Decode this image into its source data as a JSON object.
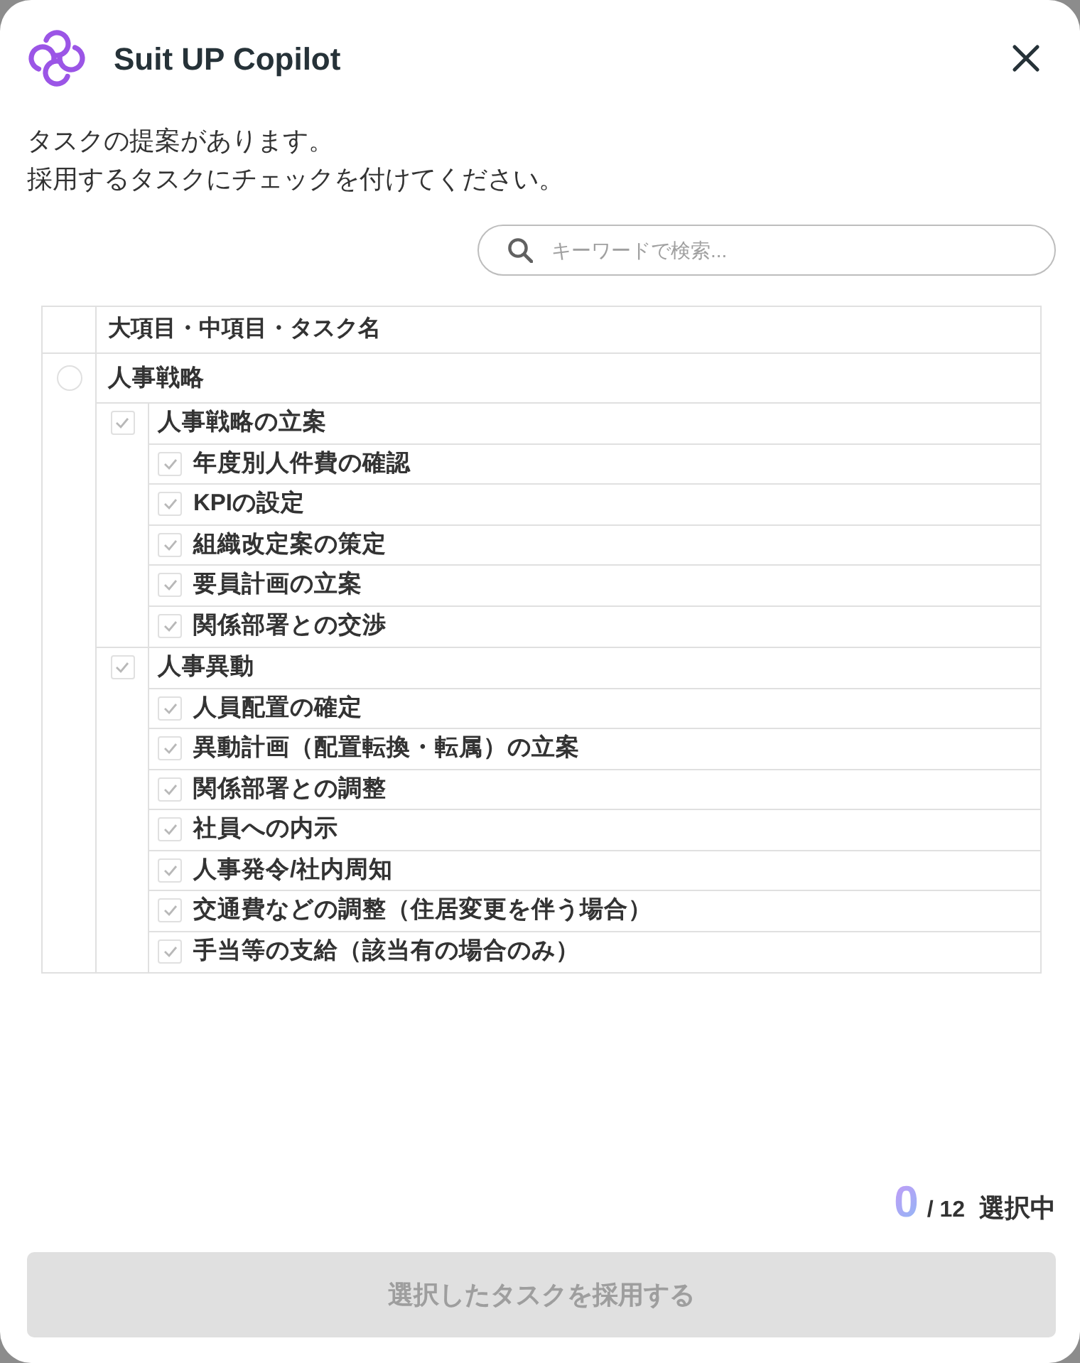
{
  "header": {
    "title": "Suit UP Copilot"
  },
  "intro": [
    "タスクの提案があります。",
    "採用するタスクにチェックを付けてください。"
  ],
  "search": {
    "placeholder": "キーワードで検索..."
  },
  "table": {
    "columns": [
      "大項目・中項目・タスク名"
    ],
    "categories": [
      {
        "label": "人事戦略",
        "selected": false,
        "children": [
          {
            "label": "人事戦略の立案",
            "checked": true,
            "disabled": true,
            "children": [
              {
                "label": "年度別人件費の確認",
                "checked": true,
                "disabled": true
              },
              {
                "label": "KPIの設定",
                "checked": true,
                "disabled": true
              },
              {
                "label": "組織改定案の策定",
                "checked": true,
                "disabled": true
              },
              {
                "label": "要員計画の立案",
                "checked": true,
                "disabled": true
              },
              {
                "label": "関係部署との交渉",
                "checked": true,
                "disabled": true
              }
            ]
          },
          {
            "label": "人事異動",
            "checked": true,
            "disabled": true,
            "children": [
              {
                "label": "人員配置の確定",
                "checked": true,
                "disabled": true
              },
              {
                "label": "異動計画（配置転換・転属）の立案",
                "checked": true,
                "disabled": true
              },
              {
                "label": "関係部署との調整",
                "checked": true,
                "disabled": true
              },
              {
                "label": "社員への内示",
                "checked": true,
                "disabled": true
              },
              {
                "label": "人事発令/社内周知",
                "checked": true,
                "disabled": true
              },
              {
                "label": "交通費などの調整（住居変更を伴う場合）",
                "checked": true,
                "disabled": true
              },
              {
                "label": "手当等の支給（該当有の場合のみ）",
                "checked": true,
                "disabled": true
              }
            ]
          }
        ]
      }
    ]
  },
  "selection": {
    "count": "0",
    "total": "/ 12",
    "label": "選択中"
  },
  "submit_button": {
    "label": "選択したタスクを採用する",
    "disabled": true
  }
}
